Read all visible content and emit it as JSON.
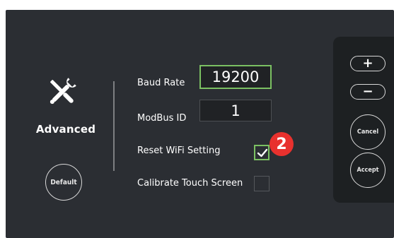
{
  "left_panel": {
    "icon": "tools-icon",
    "title": "Advanced",
    "default_label": "Default"
  },
  "settings": {
    "baud_rate": {
      "label": "Baud Rate",
      "value": "19200"
    },
    "modbus_id": {
      "label": "ModBus ID",
      "value": "1"
    },
    "reset_wifi": {
      "label": "Reset WiFi Setting",
      "checked": true
    },
    "calibrate_touch": {
      "label": "Calibrate Touch Screen",
      "checked": false
    }
  },
  "annotation": {
    "badge_number": "2"
  },
  "right_panel": {
    "plus_label": "+",
    "minus_label": "−",
    "cancel_label": "Cancel",
    "accept_label": "Accept"
  },
  "colors": {
    "background": "#2b2e33",
    "accent_green": "#7bc062",
    "badge_red": "#e8312e",
    "panel": "#1d2022"
  }
}
